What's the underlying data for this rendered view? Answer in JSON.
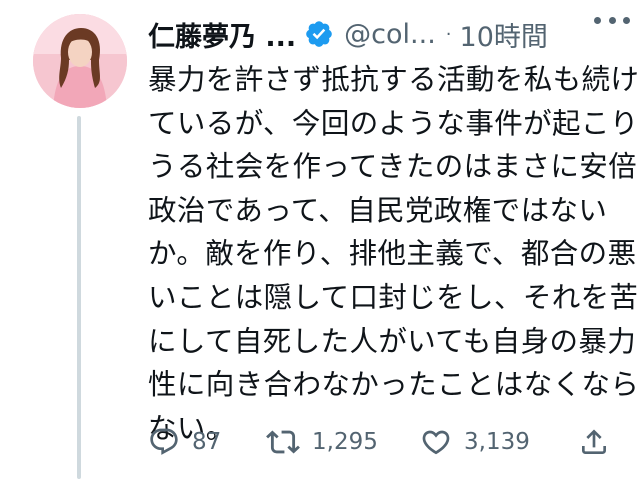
{
  "tweet": {
    "author_name": "仁藤夢乃 ...",
    "handle": "@col...",
    "separator": "·",
    "timestamp": "10時間",
    "text_lines": [
      "暴力を許さず抵抗する活動を私も続け",
      "ているが、今回のような事件が起こり",
      "うる社会を作ってきたのはまさに安倍",
      "政治であって、自民党政権ではない",
      "か。敵を作り、排他主義で、都合の悪",
      "いことは隠して口封じをし、それを苦",
      "にして自死した人がいても自身の暴力",
      "性に向き合わなかったことはなくなら",
      "ない。"
    ],
    "replies": "87",
    "retweets": "1,295",
    "likes": "3,139"
  },
  "colors": {
    "verified": "#1d9bf0",
    "icon_gray": "#536471",
    "thread_line": "#cfd9de",
    "avatar_bg": "#f7c9d3"
  },
  "icons": [
    "verified-badge-icon",
    "more-icon",
    "reply-icon",
    "retweet-icon",
    "like-icon",
    "share-icon"
  ]
}
